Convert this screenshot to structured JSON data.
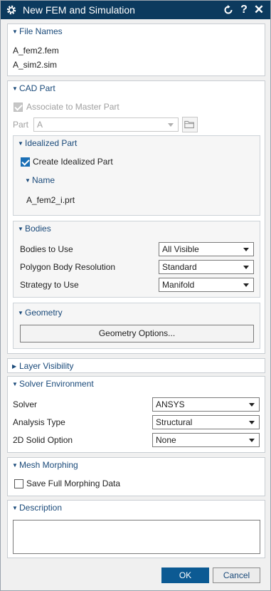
{
  "titlebar": {
    "title": "New FEM and Simulation",
    "help": "?",
    "close": "✕"
  },
  "file_names": {
    "header": "File Names",
    "fem": "A_fem2.fem",
    "sim": "A_sim2.sim"
  },
  "cad_part": {
    "header": "CAD Part",
    "associate_label": "Associate to Master Part",
    "part_label": "Part",
    "part_value": "A",
    "idealized": {
      "header": "Idealized Part",
      "create_label": "Create Idealized Part",
      "name_header": "Name",
      "name_value": "A_fem2_i.prt"
    },
    "bodies": {
      "header": "Bodies",
      "bodies_to_use_label": "Bodies to Use",
      "bodies_to_use_value": "All Visible",
      "polygon_label": "Polygon Body Resolution",
      "polygon_value": "Standard",
      "strategy_label": "Strategy to Use",
      "strategy_value": "Manifold"
    },
    "geometry": {
      "header": "Geometry",
      "button": "Geometry Options..."
    }
  },
  "layer_visibility": {
    "header": "Layer Visibility"
  },
  "solver_env": {
    "header": "Solver Environment",
    "solver_label": "Solver",
    "solver_value": "ANSYS",
    "analysis_label": "Analysis Type",
    "analysis_value": "Structural",
    "solid_label": "2D Solid Option",
    "solid_value": "None"
  },
  "mesh_morphing": {
    "header": "Mesh Morphing",
    "save_label": "Save Full Morphing Data"
  },
  "description": {
    "header": "Description",
    "value": ""
  },
  "footer": {
    "ok": "OK",
    "cancel": "Cancel"
  },
  "colors": {
    "titlebar": "#0c3a5e",
    "accent": "#1a4a7a",
    "ok_button": "#0c5a93"
  }
}
